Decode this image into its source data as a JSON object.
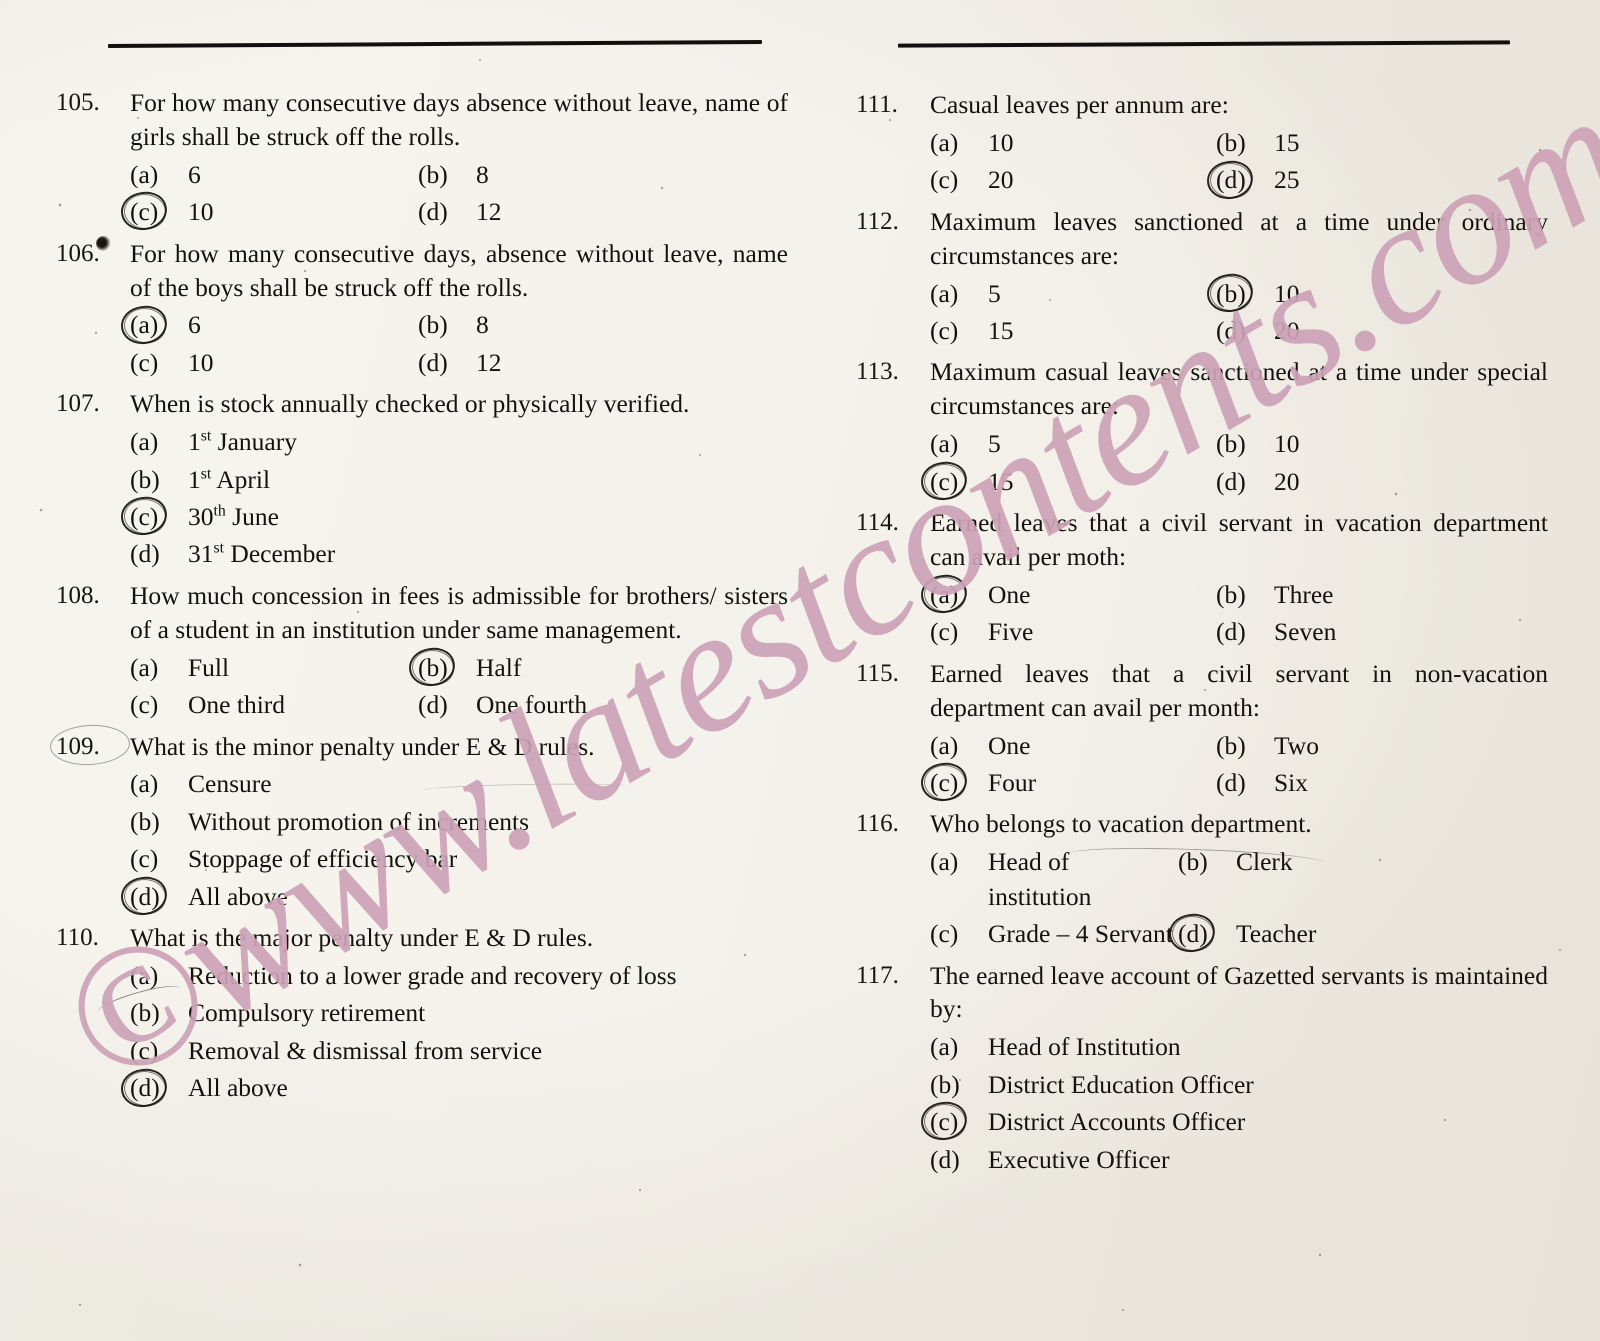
{
  "document": {
    "type": "scanned-exam-paper",
    "background_color": "#fbfaf7",
    "ink_color": "#15120d",
    "watermark": {
      "text": "©www.latestcontents.com",
      "color": "#cda2b7",
      "rotation_deg": -30.5
    }
  },
  "columns": [
    {
      "id": "left",
      "questions": [
        {
          "number": "105.",
          "number_marked": false,
          "text": "For how many consecutive days absence without leave, name of girls shall be struck off the rolls.",
          "layout": "two",
          "options": [
            {
              "label": "(a)",
              "value": "6",
              "selected": false
            },
            {
              "label": "(b)",
              "value": "8",
              "selected": false
            },
            {
              "label": "(c)",
              "value": "10",
              "selected": true
            },
            {
              "label": "(d)",
              "value": "12",
              "selected": false
            }
          ]
        },
        {
          "number": "106.",
          "number_marked": false,
          "number_smudged": true,
          "text": "For how many consecutive days, absence without leave, name of the boys shall be struck off the rolls.",
          "layout": "two",
          "options": [
            {
              "label": "(a)",
              "value": "6",
              "selected": true
            },
            {
              "label": "(b)",
              "value": "8",
              "selected": false
            },
            {
              "label": "(c)",
              "value": "10",
              "selected": false
            },
            {
              "label": "(d)",
              "value": "12",
              "selected": false
            }
          ]
        },
        {
          "number": "107.",
          "number_marked": false,
          "text": "When is stock annually checked or physically verified.",
          "layout": "stack",
          "options": [
            {
              "label": "(a)",
              "value": "1st January",
              "sup": "st",
              "base": "1",
              "tail": " January",
              "selected": false
            },
            {
              "label": "(b)",
              "value": "1st April",
              "sup": "st",
              "base": "1",
              "tail": " April",
              "selected": false
            },
            {
              "label": "(c)",
              "value": "30th June",
              "sup": "th",
              "base": "30",
              "tail": " June",
              "selected": true
            },
            {
              "label": "(d)",
              "value": "31st December",
              "sup": "st",
              "base": "31",
              "tail": " December",
              "selected": false
            }
          ]
        },
        {
          "number": "108.",
          "number_marked": false,
          "text": "How much concession in fees is admissible for brothers/ sisters of a student in an institution under same management.",
          "layout": "two",
          "options": [
            {
              "label": "(a)",
              "value": "Full",
              "selected": false
            },
            {
              "label": "(b)",
              "value": "Half",
              "selected": true
            },
            {
              "label": "(c)",
              "value": "One third",
              "selected": false
            },
            {
              "label": "(d)",
              "value": "One fourth",
              "selected": false
            }
          ]
        },
        {
          "number": "109.",
          "number_marked": true,
          "text": "What is the minor penalty under E & D rules.",
          "layout": "stack",
          "options": [
            {
              "label": "(a)",
              "value": "Censure",
              "selected": false
            },
            {
              "label": "(b)",
              "value": "Without promotion of increments",
              "selected": false
            },
            {
              "label": "(c)",
              "value": "Stoppage of efficiency bar",
              "selected": false
            },
            {
              "label": "(d)",
              "value": "All above",
              "selected": true
            }
          ]
        },
        {
          "number": "110.",
          "number_marked": false,
          "text": "What is the major penalty under E & D rules.",
          "layout": "stack",
          "options": [
            {
              "label": "(a)",
              "value": "Reduction to a lower grade and recovery of loss",
              "selected": false
            },
            {
              "label": "(b)",
              "value": "Compulsory retirement",
              "selected": false
            },
            {
              "label": "(c)",
              "value": "Removal & dismissal from service",
              "selected": false
            },
            {
              "label": "(d)",
              "value": "All above",
              "selected": true
            }
          ]
        }
      ]
    },
    {
      "id": "right",
      "questions": [
        {
          "number": "111.",
          "number_marked": false,
          "text": "Casual leaves per annum are:",
          "layout": "two",
          "options": [
            {
              "label": "(a)",
              "value": "10",
              "selected": false
            },
            {
              "label": "(b)",
              "value": "15",
              "selected": false
            },
            {
              "label": "(c)",
              "value": "20",
              "selected": false
            },
            {
              "label": "(d)",
              "value": "25",
              "selected": true
            }
          ]
        },
        {
          "number": "112.",
          "number_marked": false,
          "text": "Maximum leaves sanctioned at a time under ordinary circumstances are:",
          "layout": "two",
          "options": [
            {
              "label": "(a)",
              "value": "5",
              "selected": false
            },
            {
              "label": "(b)",
              "value": "10",
              "selected": true
            },
            {
              "label": "(c)",
              "value": "15",
              "selected": false
            },
            {
              "label": "(d)",
              "value": "20",
              "selected": false
            }
          ]
        },
        {
          "number": "113.",
          "number_marked": false,
          "text": "Maximum casual leaves sanctioned at a time under special circumstances are:",
          "layout": "two",
          "options": [
            {
              "label": "(a)",
              "value": "5",
              "selected": false
            },
            {
              "label": "(b)",
              "value": "10",
              "selected": false
            },
            {
              "label": "(c)",
              "value": "15",
              "selected": true
            },
            {
              "label": "(d)",
              "value": "20",
              "selected": false
            }
          ]
        },
        {
          "number": "114.",
          "number_marked": false,
          "text": "Earned leaves that a civil servant in vacation department can avail per moth:",
          "layout": "two",
          "options": [
            {
              "label": "(a)",
              "value": "One",
              "selected": true
            },
            {
              "label": "(b)",
              "value": "Three",
              "selected": false
            },
            {
              "label": "(c)",
              "value": "Five",
              "selected": false
            },
            {
              "label": "(d)",
              "value": "Seven",
              "selected": false
            }
          ]
        },
        {
          "number": "115.",
          "number_marked": false,
          "text": "Earned leaves that a civil servant in non-vacation department can avail per month:",
          "layout": "two",
          "options": [
            {
              "label": "(a)",
              "value": "One",
              "selected": false
            },
            {
              "label": "(b)",
              "value": "Two",
              "selected": false
            },
            {
              "label": "(c)",
              "value": "Four",
              "selected": true
            },
            {
              "label": "(d)",
              "value": "Six",
              "selected": false
            }
          ]
        },
        {
          "number": "116.",
          "number_marked": false,
          "text": "Who belongs to vacation department.",
          "layout": "two-wide",
          "options": [
            {
              "label": "(a)",
              "value": "Head of institution",
              "selected": false
            },
            {
              "label": "(b)",
              "value": "Clerk",
              "selected": false
            },
            {
              "label": "(c)",
              "value": "Grade – 4 Servant",
              "selected": false
            },
            {
              "label": "(d)",
              "value": "Teacher",
              "selected": true
            }
          ]
        },
        {
          "number": "117.",
          "number_marked": false,
          "text": "The earned leave account of Gazetted servants is maintained by:",
          "layout": "stack",
          "options": [
            {
              "label": "(a)",
              "value": "Head of Institution",
              "selected": false
            },
            {
              "label": "(b)",
              "value": "District Education Officer",
              "selected": false
            },
            {
              "label": "(c)",
              "value": "District Accounts Officer",
              "selected": true
            },
            {
              "label": "(d)",
              "value": "Executive Officer",
              "selected": false
            }
          ]
        }
      ]
    }
  ]
}
